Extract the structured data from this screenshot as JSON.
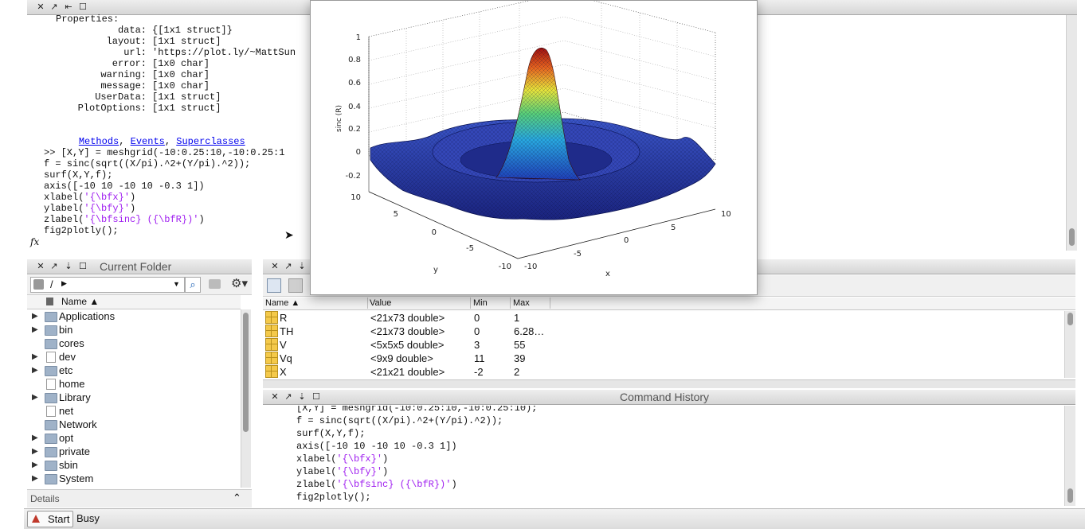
{
  "command_window": {
    "properties_header": "Properties:",
    "properties": [
      {
        "key": "data:",
        "value": "{[1x1 struct]}"
      },
      {
        "key": "layout:",
        "value": "[1x1 struct]"
      },
      {
        "key": "url:",
        "value": "'https://plot.ly/~MattSun"
      },
      {
        "key": "error:",
        "value": "[1x0 char]"
      },
      {
        "key": "warning:",
        "value": "[1x0 char]"
      },
      {
        "key": "message:",
        "value": "[1x0 char]"
      },
      {
        "key": "UserData:",
        "value": "[1x1 struct]"
      },
      {
        "key": "PlotOptions:",
        "value": "[1x1 struct]"
      }
    ],
    "links": {
      "methods": "Methods",
      "events": "Events",
      "superclasses": "Superclasses",
      "sep": ", "
    },
    "code": [
      {
        "a": ">> [X,Y] = meshgrid(-10:0.25:10,-10:0.25:1",
        "b": "",
        "c": ""
      },
      {
        "a": "f = sinc(sqrt((X/pi).^2+(Y/pi).^2));",
        "b": "",
        "c": ""
      },
      {
        "a": "surf(X,Y,f);",
        "b": "",
        "c": ""
      },
      {
        "a": "axis([-10 10 -10 10 -0.3 1])",
        "b": "",
        "c": ""
      },
      {
        "a": "xlabel(",
        "b": "'{\\bfx}'",
        "c": ")"
      },
      {
        "a": "ylabel(",
        "b": "'{\\bfy}'",
        "c": ")"
      },
      {
        "a": "zlabel(",
        "b": "'{\\bfsinc} ({\\bfR})'",
        "c": ")"
      },
      {
        "a": "fig2plotly();",
        "b": "",
        "c": ""
      }
    ],
    "fx_label": "fx"
  },
  "current_folder": {
    "title": "Current Folder",
    "path": "/",
    "column_name": "Name ▲",
    "items": [
      {
        "name": "Applications",
        "expandable": true,
        "kind": "folder"
      },
      {
        "name": "bin",
        "expandable": true,
        "kind": "folder"
      },
      {
        "name": "cores",
        "expandable": false,
        "kind": "folder"
      },
      {
        "name": "dev",
        "expandable": true,
        "kind": "file"
      },
      {
        "name": "etc",
        "expandable": true,
        "kind": "folder"
      },
      {
        "name": "home",
        "expandable": false,
        "kind": "file"
      },
      {
        "name": "Library",
        "expandable": true,
        "kind": "folder"
      },
      {
        "name": "net",
        "expandable": false,
        "kind": "file"
      },
      {
        "name": "Network",
        "expandable": false,
        "kind": "folder"
      },
      {
        "name": "opt",
        "expandable": true,
        "kind": "folder"
      },
      {
        "name": "private",
        "expandable": true,
        "kind": "folder"
      },
      {
        "name": "sbin",
        "expandable": true,
        "kind": "folder"
      },
      {
        "name": "System",
        "expandable": true,
        "kind": "folder"
      }
    ],
    "details_label": "Details"
  },
  "workspace": {
    "columns": [
      "Name ▲",
      "Value",
      "Min",
      "Max"
    ],
    "rows": [
      {
        "name": "R",
        "value": "<21x73 double>",
        "min": "0",
        "max": "1"
      },
      {
        "name": "TH",
        "value": "<21x73 double>",
        "min": "0",
        "max": "6.28…"
      },
      {
        "name": "V",
        "value": "<5x5x5 double>",
        "min": "3",
        "max": "55"
      },
      {
        "name": "Vq",
        "value": "<9x9 double>",
        "min": "11",
        "max": "39"
      },
      {
        "name": "X",
        "value": "<21x21 double>",
        "min": "-2",
        "max": "2"
      }
    ]
  },
  "command_history": {
    "title": "Command History",
    "lines": [
      {
        "a": "[X,Y] = meshgrid(-10:0.25:10,-10:0.25:10);",
        "b": "",
        "c": ""
      },
      {
        "a": "f = sinc(sqrt((X/pi).^2+(Y/pi).^2));",
        "b": "",
        "c": ""
      },
      {
        "a": "surf(X,Y,f);",
        "b": "",
        "c": ""
      },
      {
        "a": "axis([-10 10 -10 10 -0.3 1])",
        "b": "",
        "c": ""
      },
      {
        "a": "xlabel(",
        "b": "'{\\bfx}'",
        "c": ")"
      },
      {
        "a": "ylabel(",
        "b": "'{\\bfy}'",
        "c": ")"
      },
      {
        "a": "zlabel(",
        "b": "'{\\bfsinc} ({\\bfR})'",
        "c": ")"
      },
      {
        "a": "fig2plotly();",
        "b": "",
        "c": ""
      }
    ]
  },
  "status_bar": {
    "start_label": "Start",
    "status": "Busy"
  },
  "figure": {
    "zlabel": "sinc (R)",
    "xlabel": "x",
    "ylabel": "y",
    "z_ticks": [
      "1",
      "0.8",
      "0.6",
      "0.4",
      "0.2",
      "0",
      "-0.2"
    ],
    "x_ticks": [
      "-10",
      "-5",
      "0",
      "5",
      "10"
    ],
    "y_ticks": [
      "10",
      "5",
      "0",
      "-5",
      "-10"
    ]
  },
  "colors": {
    "link": "#0000ee",
    "string": "#a020f0",
    "surface_low": "#1e2a8c",
    "surface_high": "#8b0000"
  }
}
